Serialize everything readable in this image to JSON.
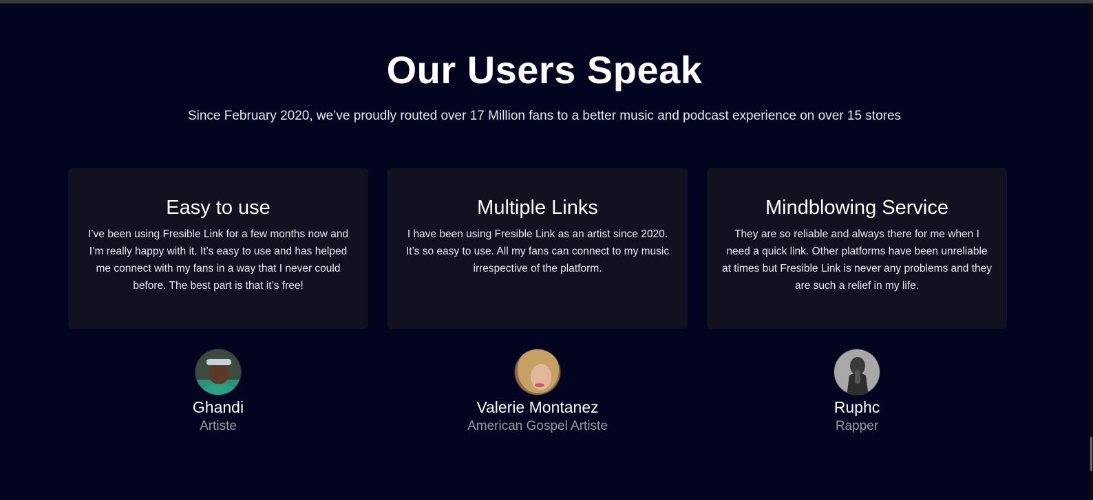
{
  "section": {
    "title": "Our Users Speak",
    "subtitle": "Since February 2020, we’ve proudly routed over 17 Million fans to a better music and podcast experience on over 15 stores"
  },
  "testimonials": [
    {
      "title": "Easy to use",
      "text": "I’ve been using Fresible Link for a few months now and I’m really happy with it. It’s easy to use and has helped me connect with my fans in a way that I never could before. The best part is that it’s free!",
      "name": "Ghandi",
      "role": "Artiste",
      "avatar_icon": "user-photo-icon"
    },
    {
      "title": "Multiple Links",
      "text": "I have been using Fresible Link as an artist since 2020. It’s so easy to use. All my fans can connect to my music irrespective of the platform.",
      "name": "Valerie Montanez",
      "role": "American Gospel Artiste",
      "avatar_icon": "user-photo-icon"
    },
    {
      "title": "Mindblowing Service",
      "text": "They are so reliable and always there for me when I need a quick link. Other platforms have been unreliable at times but Fresible Link is never any problems and they are such a relief in my life.",
      "name": "Ruphc",
      "role": "Rapper",
      "avatar_icon": "user-photo-icon"
    }
  ],
  "colors": {
    "background": "#020420",
    "card": "#11111f",
    "muted_text": "#9a9aa6"
  }
}
